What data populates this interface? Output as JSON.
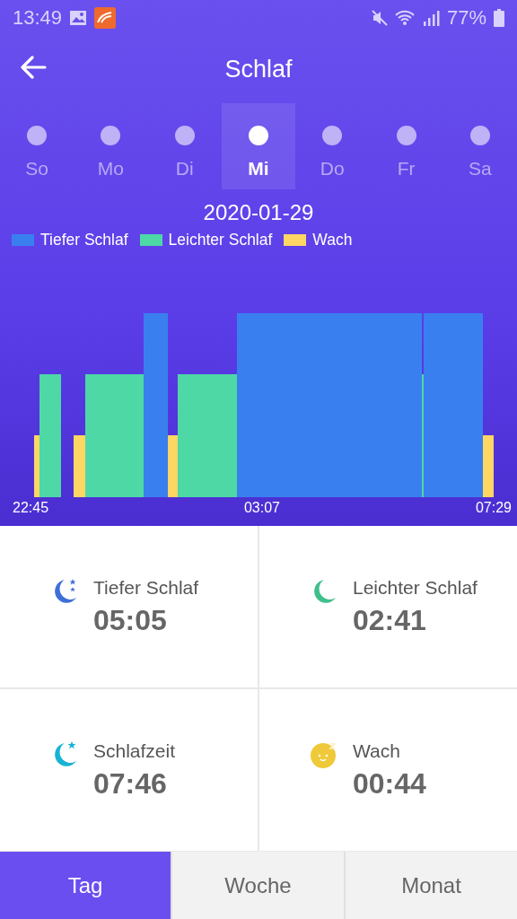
{
  "status_bar": {
    "time": "13:49",
    "battery": "77%"
  },
  "header": {
    "title": "Schlaf"
  },
  "days": [
    {
      "label": "So",
      "selected": false
    },
    {
      "label": "Mo",
      "selected": false
    },
    {
      "label": "Di",
      "selected": false
    },
    {
      "label": "Mi",
      "selected": true
    },
    {
      "label": "Do",
      "selected": false
    },
    {
      "label": "Fr",
      "selected": false
    },
    {
      "label": "Sa",
      "selected": false
    }
  ],
  "date": "2020-01-29",
  "legend": [
    {
      "label": "Tiefer Schlaf",
      "color": "#3a7ff0"
    },
    {
      "label": "Leichter Schlaf",
      "color": "#4ed8a6"
    },
    {
      "label": "Wach",
      "color": "#fdd663"
    }
  ],
  "time_labels": [
    "22:45",
    "03:07",
    "07:29"
  ],
  "stats": [
    {
      "kind": "deep",
      "label": "Tiefer Schlaf",
      "value": "05:05"
    },
    {
      "kind": "light",
      "label": "Leichter Schlaf",
      "value": "02:41"
    },
    {
      "kind": "total",
      "label": "Schlafzeit",
      "value": "07:46"
    },
    {
      "kind": "awake",
      "label": "Wach",
      "value": "00:44"
    }
  ],
  "tabs": [
    {
      "label": "Tag",
      "selected": true
    },
    {
      "label": "Woche",
      "selected": false
    },
    {
      "label": "Monat",
      "selected": false
    }
  ]
}
